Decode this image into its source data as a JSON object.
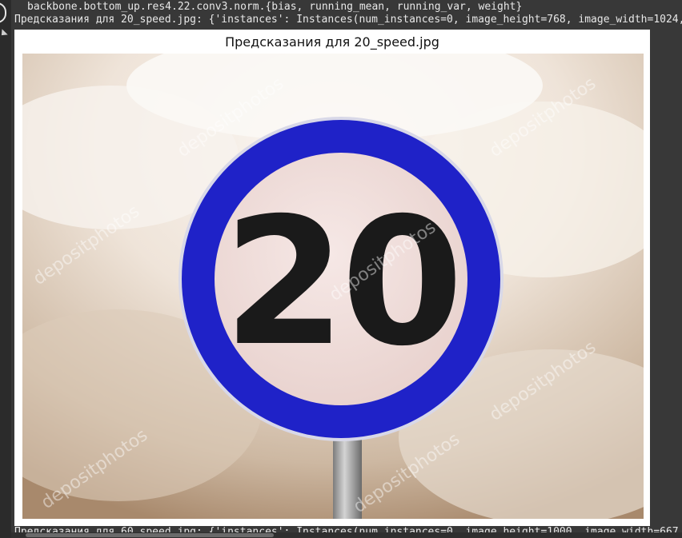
{
  "output": {
    "line1": "backbone.bottom_up.res4.22.conv3.norm.{bias, running_mean, running_var, weight}",
    "line2": "Предсказания для 20_speed.jpg: {'instances': Instances(num_instances=0, image_height=768, image_width=1024, ",
    "line3": "Предсказания для 60_speed.jpg: {'instances': Instances(num_instances=0, image_height=1000, image_width=667,"
  },
  "figure": {
    "title": "Предсказания для 20_speed.jpg",
    "sign_number": "20",
    "watermark": "depositphotos"
  },
  "colors": {
    "sign_ring": "#1f22c8",
    "sign_face": "#f1dfdc",
    "digits": "#1a1a1a",
    "sky_light": "#f6f0ea",
    "sky_dark": "#b39a80"
  }
}
